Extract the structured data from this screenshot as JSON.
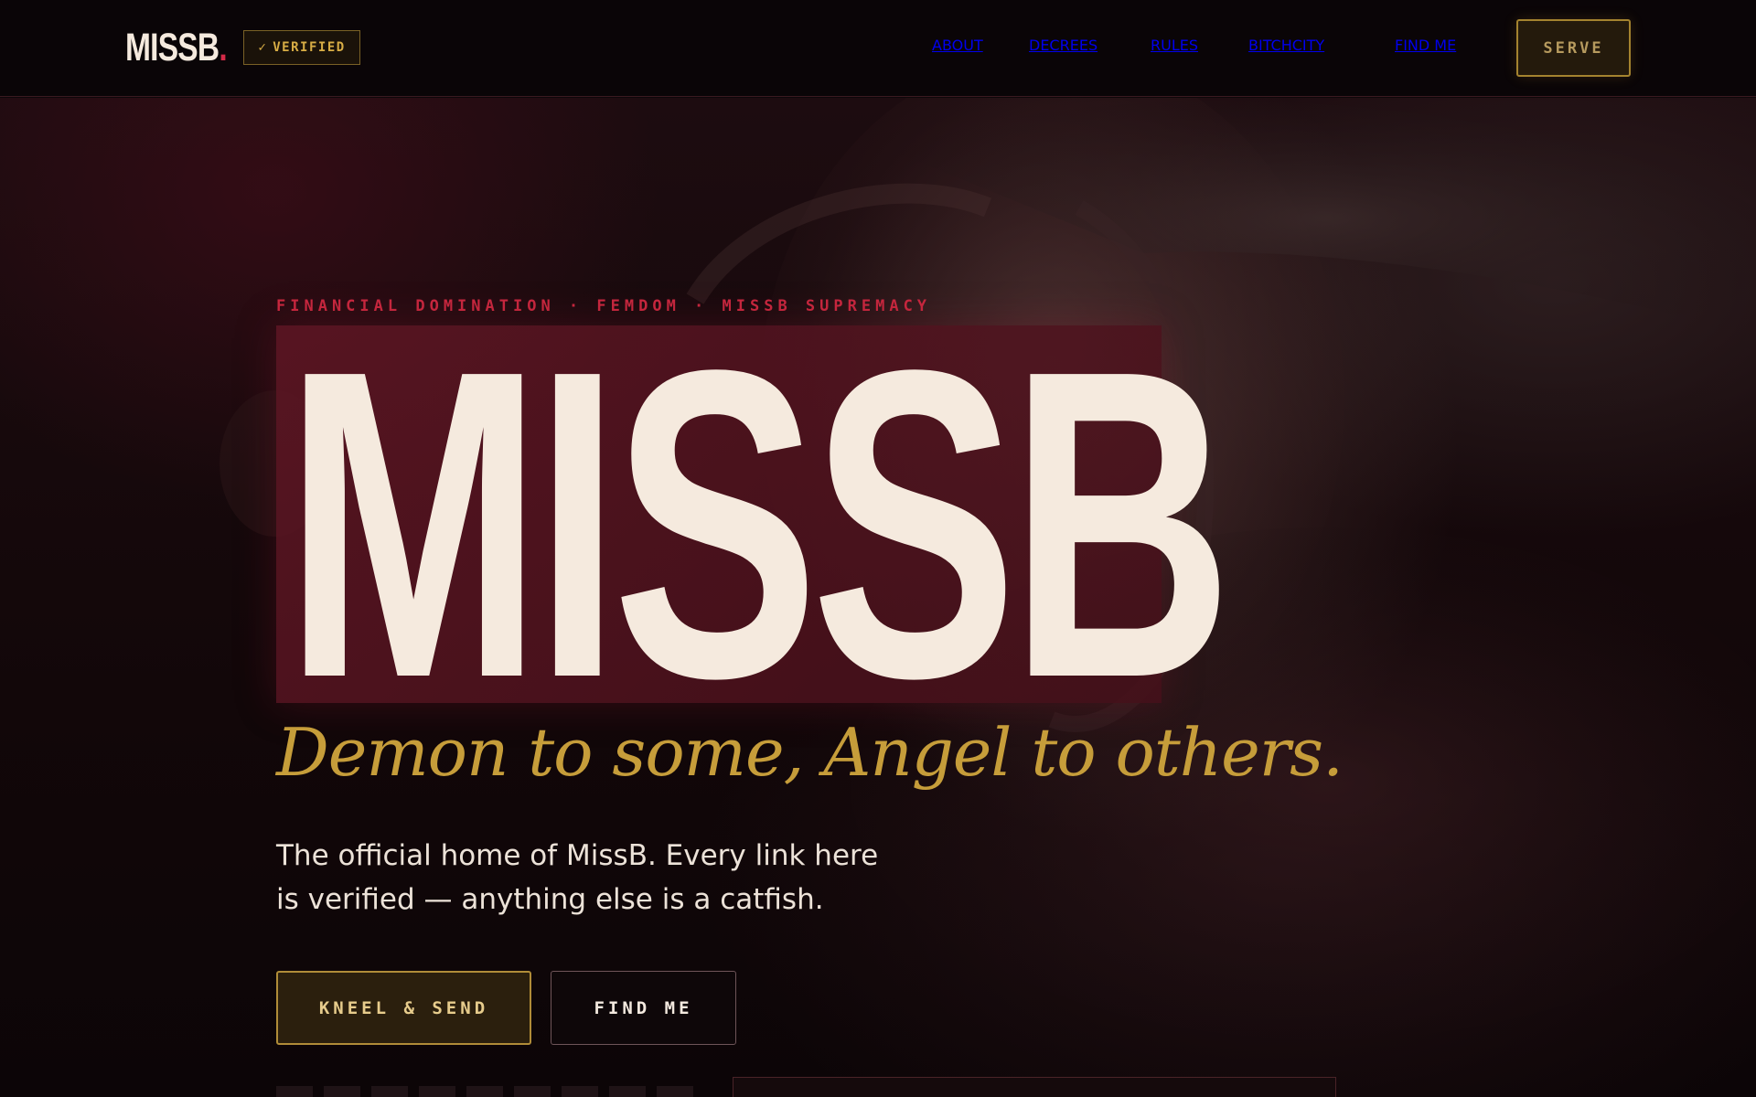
{
  "brand": {
    "logo": "MISSB",
    "logo_dot": ".",
    "verified_check": "✓",
    "verified_label": "VERIFIED"
  },
  "nav": {
    "items": [
      {
        "label": "ABOUT"
      },
      {
        "label": "DECREES"
      },
      {
        "label": "RULES"
      },
      {
        "label": "BITCHCITY"
      },
      {
        "label": "FIND ME"
      }
    ],
    "cta": "SERVE"
  },
  "hero": {
    "eyebrow": "FINANCIAL DOMINATION · FEMDOM · MISSB SUPREMACY",
    "title": "MISSB",
    "tagline": "Demon to some, Angel to others.",
    "lede": "The official home of MissB. Every link here is verified — anything else is a catfish.",
    "primary_button": "KNEEL & SEND",
    "secondary_button": "FIND ME"
  },
  "colors": {
    "background": "#0d0709",
    "accent_red": "#c9283f",
    "accent_gold": "#c69d3a",
    "cream": "#f5eade"
  }
}
